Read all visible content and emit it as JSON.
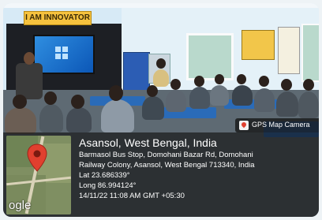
{
  "scene": {
    "banner_text": "I AM INNOVATOR"
  },
  "gps_tag": {
    "label": "GPS Map Camera",
    "icon": "gps-map-camera-icon"
  },
  "location": {
    "title": "Asansol, West Bengal, India",
    "address_line_1": "Barmasol Bus Stop, Domohani Bazar Rd, Domohani",
    "address_line_2": "Railway Colony, Asansol, West Bengal 713340, India",
    "latitude": "Lat 23.686339°",
    "longitude": "Long 86.994124°",
    "timestamp": "14/11/22 11:08 AM GMT +05:30"
  },
  "map": {
    "logo_text": "ogle",
    "pin_icon": "location-pin-icon",
    "pin_color": "#e0402f"
  }
}
